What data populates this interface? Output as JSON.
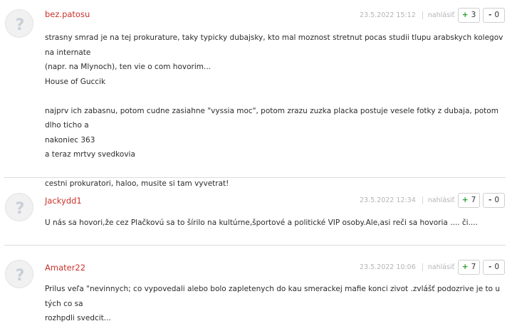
{
  "comments": [
    {
      "author": "bez.patosu",
      "date": "23.5.2022 15:12",
      "report_label": "nahlásiť",
      "upvotes": "3",
      "downvotes": "0",
      "plus_sign": "+",
      "minus_sign": "-",
      "lines": [
        "strasny smrad je na tej prokurature, taky typicky dubajsky, kto mal moznost stretnut pocas studii tlupu arabskych kolegov na internate",
        "(napr. na Mlynoch), ten vie o com hovorim...",
        "House of Guccik",
        "",
        "najprv ich zabasnu, potom cudne zasiahne \"vyssia moc\", potom zrazu zuzka placka postuje vesele fotky z dubaja, potom dlho ticho a",
        "nakoniec 363",
        "a teraz mrtvy svedkovia",
        "",
        "cestni prokuratori, haloo, musite si tam vyvetrat!"
      ]
    },
    {
      "author": "Jackydd1",
      "date": "23.5.2022 12:34",
      "report_label": "nahlásiť",
      "upvotes": "7",
      "downvotes": "0",
      "plus_sign": "+",
      "minus_sign": "-",
      "lines": [
        "U nás sa hovori,že cez Plačkovú sa to šírilo na kultúrne,športové a politické VIP osoby.Ale,asi reči sa hovoria .... či...."
      ]
    },
    {
      "author": "Amater22",
      "date": "23.5.2022 10:06",
      "report_label": "nahlásiť",
      "upvotes": "7",
      "downvotes": "0",
      "plus_sign": "+",
      "minus_sign": "-",
      "lines": [
        "Prilus veľa \"nevinnych; co vypovedali alebo bolo zapletenych do kau smerackej mafie konci zivot .zvlášť podozrive je to u tých co sa",
        "rozhpdli svedcit..."
      ]
    }
  ],
  "icons": {
    "avatar": "default-avatar-question-icon"
  },
  "colors": {
    "author": "#c8322b",
    "upvote": "#2e9e2e",
    "meta": "#b5b5b5",
    "divider": "#dcdcdc"
  }
}
